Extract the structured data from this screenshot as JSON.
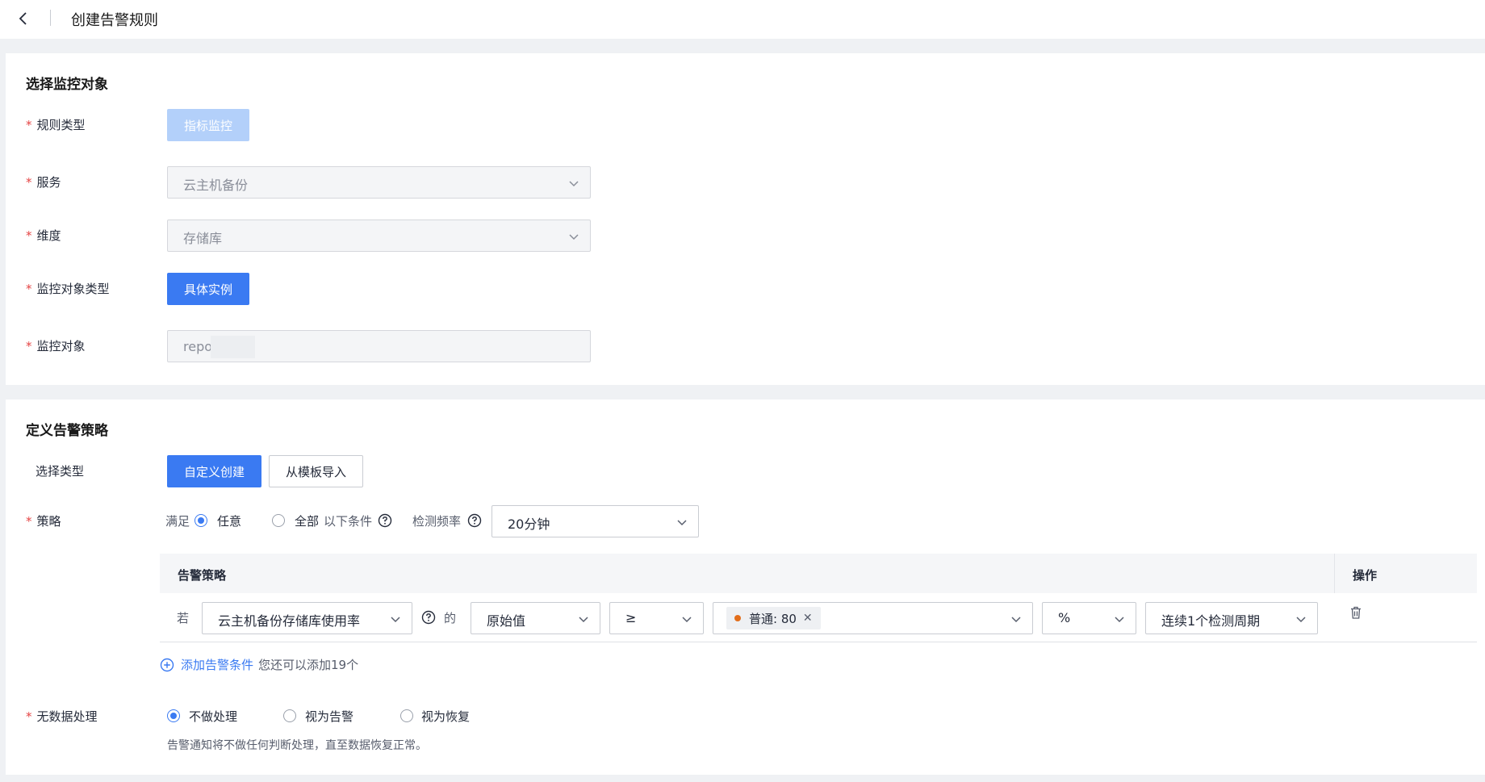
{
  "header": {
    "title": "创建告警规则"
  },
  "monitor_section": {
    "title": "选择监控对象",
    "rule_type": {
      "label": "规则类型",
      "button": "指标监控"
    },
    "service": {
      "label": "服务",
      "value": "云主机备份"
    },
    "dimension": {
      "label": "维度",
      "value": "存储库"
    },
    "object_type": {
      "label": "监控对象类型",
      "button": "具体实例"
    },
    "object": {
      "label": "监控对象",
      "value": "repo"
    }
  },
  "policy_section": {
    "title": "定义告警策略",
    "select_type": {
      "label": "选择类型",
      "options": [
        "自定义创建",
        "从模板导入"
      ]
    },
    "strategy": {
      "label": "策略",
      "satisfy": "满足",
      "any": "任意",
      "all": "全部",
      "conditions_suffix": "以下条件",
      "frequency_label": "检测频率",
      "frequency_value": "20分钟"
    },
    "table": {
      "col_policy": "告警策略",
      "col_action": "操作",
      "row": {
        "if": "若",
        "metric": "云主机备份存储库使用率",
        "of": "的",
        "value_type": "原始值",
        "operator": "≥",
        "threshold_tag": "普通: 80",
        "unit": "%",
        "period": "连续1个检测周期"
      }
    },
    "add_condition": "添加告警条件",
    "add_hint": "您还可以添加19个",
    "no_data": {
      "label": "无数据处理",
      "options": [
        "不做处理",
        "视为告警",
        "视为恢复"
      ],
      "hint": "告警通知将不做任何判断处理，直至数据恢复正常。"
    }
  },
  "colors": {
    "primary": "#3a7af2",
    "required": "#e54545",
    "warning_dot": "#e26e1b"
  }
}
